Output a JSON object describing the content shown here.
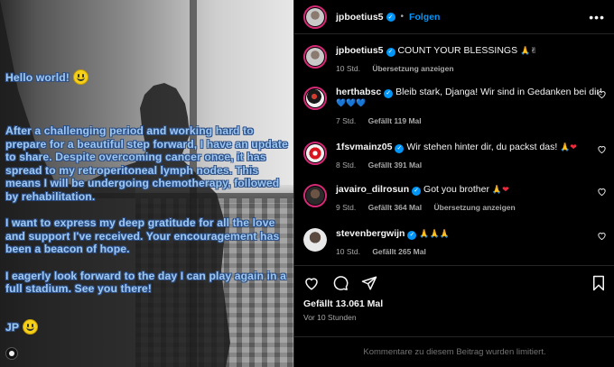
{
  "photo": {
    "greeting": "Hello world!",
    "paragraphs": [
      "After a challenging period and working hard to prepare for a beautiful step forward, I have an update to share. Despite overcoming cancer once, it has spread to my retroperitoneal lymph nodes. This means I will be undergoing chemotherapy, followed by rehabilitation.",
      "I want to express my deep gratitude for all the love and support I've received. Your encouragement has been a beacon of hope.",
      "I eagerly look forward to the day I can play again in a full stadium. See you there!"
    ],
    "signature": "JP"
  },
  "header": {
    "username": "jpboetius5",
    "follow_label": "Folgen",
    "more_label": "•••"
  },
  "caption": {
    "username": "jpboetius5",
    "text": "COUNT YOUR BLESSINGS",
    "emojis": "🙏✌",
    "time": "10 Std.",
    "translate": "Übersetzung anzeigen"
  },
  "comments": [
    {
      "username": "herthabsc",
      "text": "Bleib stark, Djanga! Wir sind in Gedanken bei dir!",
      "emojis": "💙💙💙",
      "time": "7 Std.",
      "likes": "Gefällt 119 Mal",
      "translate": ""
    },
    {
      "username": "1fsvmainz05",
      "text": "Wir stehen hinter dir, du packst das!",
      "emojis": "🙏❤",
      "time": "8 Std.",
      "likes": "Gefällt 391 Mal",
      "translate": ""
    },
    {
      "username": "javairo_dilrosun",
      "text": "Got you brother",
      "emojis": "🙏❤",
      "time": "9 Std.",
      "likes": "Gefällt 364 Mal",
      "translate": "Übersetzung anzeigen"
    },
    {
      "username": "stevenbergwijn",
      "text": "",
      "emojis": "🙏🙏🙏",
      "time": "10 Std.",
      "likes": "Gefällt 265 Mal",
      "translate": ""
    }
  ],
  "post": {
    "likes": "Gefällt 13.061 Mal",
    "time": "Vor 10 Stunden"
  },
  "footer": {
    "notice": "Kommentare zu diesem Beitrag wurden limitiert."
  },
  "colors": {
    "accent": "#0095f6",
    "overlay_text": "#9ec8f0",
    "background": "#000000",
    "muted": "#a8a8a8"
  },
  "icons": [
    "heart-icon",
    "comment-icon",
    "share-icon",
    "bookmark-icon",
    "verified-icon",
    "more-icon"
  ]
}
